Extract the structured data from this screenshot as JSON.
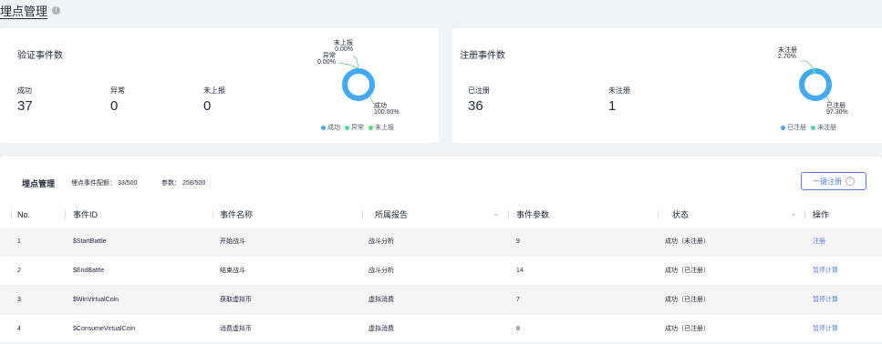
{
  "page": {
    "title": "埋点管理",
    "info_icon": "info-icon"
  },
  "verify_card": {
    "title": "验证事件数",
    "stats": [
      {
        "label": "成功",
        "value": "37"
      },
      {
        "label": "异常",
        "value": "0"
      },
      {
        "label": "未上报",
        "value": "0"
      }
    ],
    "chart_data": {
      "type": "pie",
      "categories": [
        "成功",
        "异常",
        "未上报"
      ],
      "values": [
        100.0,
        0.0,
        0.0
      ],
      "labels": [
        {
          "name": "未上报",
          "pct": "0.00%"
        },
        {
          "name": "异常",
          "pct": "0.00%"
        },
        {
          "name": "成功",
          "pct": "100.00%"
        }
      ],
      "colors": [
        "#41a9f5",
        "#50d4ab",
        "#5cd86e"
      ],
      "legend": [
        "成功",
        "异常",
        "未上报"
      ],
      "legend_position": "bottom"
    }
  },
  "register_card": {
    "title": "注册事件数",
    "stats": [
      {
        "label": "已注册",
        "value": "36"
      },
      {
        "label": "未注册",
        "value": "1"
      }
    ],
    "chart_data": {
      "type": "pie",
      "categories": [
        "已注册",
        "未注册"
      ],
      "values": [
        97.3,
        2.7
      ],
      "labels": [
        {
          "name": "未注册",
          "pct": "2.70%"
        },
        {
          "name": "已注册",
          "pct": "97.30%"
        }
      ],
      "colors": [
        "#41a9f5",
        "#50d4ab"
      ],
      "legend": [
        "已注册",
        "未注册"
      ],
      "legend_position": "bottom"
    }
  },
  "table_card": {
    "title": "埋点管理",
    "quota": "埋点事件配额： 33/500",
    "params": "参数： 258/500",
    "register_all_button": "一键注册",
    "help_icon": "?",
    "columns": [
      "No.",
      "事件ID",
      "事件名称",
      "所属报告",
      "事件参数",
      "状态",
      "操作"
    ],
    "rows": [
      {
        "no": "1",
        "id": "$StartBattle",
        "name": "开始战斗",
        "report": "战斗分析",
        "params": "9",
        "status": "成功（未注册）",
        "action": "注册"
      },
      {
        "no": "2",
        "id": "$EndBattle",
        "name": "结束战斗",
        "report": "战斗分析",
        "params": "14",
        "status": "成功（已注册）",
        "action": "暂停计算"
      },
      {
        "no": "3",
        "id": "$WinVirtualCoin",
        "name": "获取虚拟币",
        "report": "虚拟消费",
        "params": "7",
        "status": "成功（已注册）",
        "action": "暂停计算"
      },
      {
        "no": "4",
        "id": "$ConsumeVirtualCoin",
        "name": "消费虚拟币",
        "report": "虚拟消费",
        "params": "8",
        "status": "成功（已注册）",
        "action": "暂停计算"
      }
    ]
  }
}
